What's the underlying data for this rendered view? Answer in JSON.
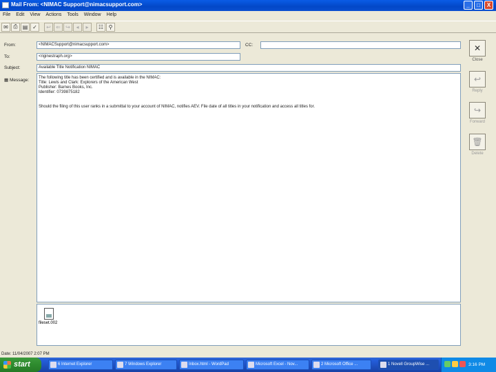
{
  "window": {
    "title": "Mail From: <NIMAC Support@nimacsupport.com>",
    "controls": [
      "_",
      "□",
      "X"
    ]
  },
  "menu": [
    "File",
    "Edit",
    "View",
    "Actions",
    "Tools",
    "Window",
    "Help"
  ],
  "form": {
    "from_label": "From:",
    "from_value": "<NIMACSupport@nimacsupport.com>",
    "cc_label": "CC:",
    "cc_value": "",
    "to_label": "To:",
    "to_value": "<riginestraph.org>",
    "subject_label": "Subject:",
    "subject_value": "Available Title Notification NIMAC",
    "message_label": "Message:"
  },
  "message": {
    "lines": [
      "The following title has been certified and is available in the NIMAC:",
      "Title: Lewis and Clark: Explorers of the American West",
      "Publisher: Barnes Books, Inc.",
      "Identifier: 0739875182",
      "",
      "",
      "Should the filing of this user ranks in a submittal to your account of NIMAC, notifies AEV. File date of all titles in your notification and access all titles for."
    ]
  },
  "attachment": {
    "name": "fileset.002"
  },
  "side_actions": [
    {
      "label": "Close",
      "icon": "close-icon",
      "glyph": "✕",
      "enabled": true
    },
    {
      "label": "Reply",
      "icon": "reply-icon",
      "glyph": "↩",
      "enabled": false
    },
    {
      "label": "Forward",
      "icon": "forward-icon",
      "glyph": "↪",
      "enabled": false
    },
    {
      "label": "Delete",
      "icon": "trash-icon",
      "glyph": "🗑",
      "enabled": false
    }
  ],
  "status": {
    "text": "Date: 11/04/2007 2:07 PM"
  },
  "taskbar": {
    "start_label": "start",
    "tasks": [
      {
        "label": "6 Internet Explorer"
      },
      {
        "label": "7 Windows Explorer"
      },
      {
        "label": "Inbox.html - WordPad"
      },
      {
        "label": "Microsoft Excel - Nov..."
      },
      {
        "label": "2 Microsoft Office ..."
      },
      {
        "label": "1 Novell GroupWise ..."
      }
    ],
    "clock": "3:16 PM"
  }
}
